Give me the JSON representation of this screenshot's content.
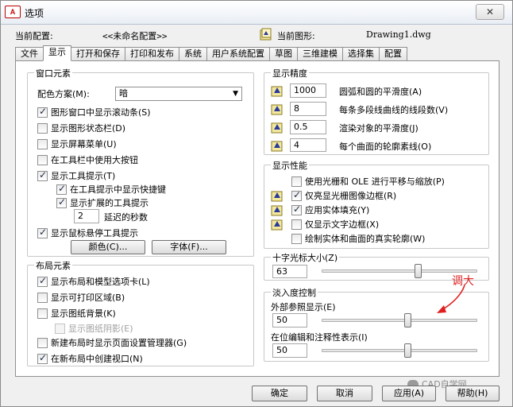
{
  "window": {
    "title": "选项",
    "app_icon": "A",
    "close_symbol": "✕"
  },
  "header": {
    "config_label": "当前配置:",
    "config_value": "<<未命名配置>>",
    "drawing_label": "当前图形:",
    "drawing_value": "Drawing1.dwg"
  },
  "tabs": [
    {
      "label": "文件"
    },
    {
      "label": "显示"
    },
    {
      "label": "打开和保存"
    },
    {
      "label": "打印和发布"
    },
    {
      "label": "系统"
    },
    {
      "label": "用户系统配置"
    },
    {
      "label": "草图"
    },
    {
      "label": "三维建模"
    },
    {
      "label": "选择集"
    },
    {
      "label": "配置"
    }
  ],
  "window_elements": {
    "title": "窗口元素",
    "color_scheme_label": "配色方案(M):",
    "color_scheme_value": "暗",
    "items": [
      {
        "label": "图形窗口中显示滚动条(S)",
        "checked": true
      },
      {
        "label": "显示图形状态栏(D)",
        "checked": false
      },
      {
        "label": "显示屏幕菜单(U)",
        "checked": false
      },
      {
        "label": "在工具栏中使用大按钮",
        "checked": false
      },
      {
        "label": "显示工具提示(T)",
        "checked": true
      },
      {
        "label": "在工具提示中显示快捷键",
        "checked": true
      },
      {
        "label": "显示扩展的工具提示",
        "checked": true
      },
      {
        "label": "显示鼠标悬停工具提示",
        "checked": true
      }
    ],
    "delay_value": "2",
    "delay_label": "延迟的秒数",
    "colors_button": "颜色(C)...",
    "fonts_button": "字体(F)..."
  },
  "layout_elements": {
    "title": "布局元素",
    "items": [
      {
        "label": "显示布局和模型选项卡(L)",
        "checked": true
      },
      {
        "label": "显示可打印区域(B)",
        "checked": false
      },
      {
        "label": "显示图纸背景(K)",
        "checked": false
      },
      {
        "label": "显示图纸阴影(E)",
        "checked": false
      },
      {
        "label": "新建布局时显示页面设置管理器(G)",
        "checked": false
      },
      {
        "label": "在新布局中创建视口(N)",
        "checked": true
      }
    ]
  },
  "display_resolution": {
    "title": "显示精度",
    "items": [
      {
        "value": "1000",
        "label": "圆弧和圆的平滑度(A)"
      },
      {
        "value": "8",
        "label": "每条多段线曲线的线段数(V)"
      },
      {
        "value": "0.5",
        "label": "渲染对象的平滑度(J)"
      },
      {
        "value": "4",
        "label": "每个曲面的轮廓素线(O)"
      }
    ]
  },
  "display_performance": {
    "title": "显示性能",
    "items": [
      {
        "label": "使用光栅和 OLE 进行平移与缩放(P)",
        "checked": false
      },
      {
        "label": "仅亮显光栅图像边框(R)",
        "checked": true
      },
      {
        "label": "应用实体填充(Y)",
        "checked": true
      },
      {
        "label": "仅显示文字边框(X)",
        "checked": false
      },
      {
        "label": "绘制实体和曲面的真实轮廓(W)",
        "checked": false
      }
    ]
  },
  "crosshair": {
    "title": "十字光标大小(Z)",
    "value": "63",
    "level": 63
  },
  "fade": {
    "title": "淡入度控制",
    "xref_label": "外部参照显示(E)",
    "xref_value": "50",
    "xref_level": 50,
    "inplace_label": "在位编辑和注释性表示(I)",
    "inplace_value": "50",
    "inplace_level": 50
  },
  "annotation": {
    "text": "调大",
    "color": "#e02020"
  },
  "buttons": {
    "ok": "确定",
    "cancel": "取消",
    "apply": "应用(A)",
    "help": "帮助(H)"
  },
  "watermark": {
    "text": "CAD自学网"
  }
}
